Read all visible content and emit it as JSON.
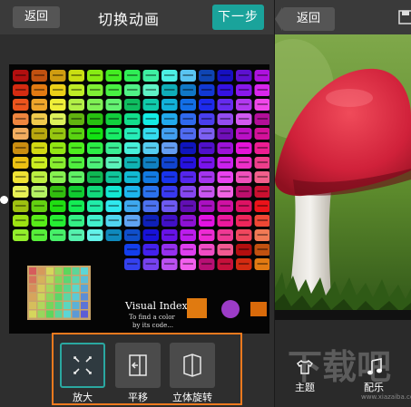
{
  "left": {
    "header": {
      "back_label": "返回",
      "title": "切换动画",
      "next_label": "下一步"
    },
    "preview": {
      "colors": [
        "#ff0000",
        "#ff3300",
        "#ff6600",
        "#ff9900",
        "#ffcc00",
        "#ffff00",
        "#ccff00",
        "#99ff00",
        "#66ff00",
        "#33ff00",
        "#00ff00",
        "#00ff33",
        "#00ff66",
        "#00ff99",
        "#00ffcc",
        "#00ffff",
        "#00ccff",
        "#0099ff",
        "#0066ff",
        "#0033ff",
        "#0000ff",
        "#3300ff",
        "#6600ff",
        "#9900ff",
        "#cc00ff",
        "#ff00ff",
        "#ff00cc",
        "#ff0099",
        "#ff0066",
        "#ff0033",
        "#993300",
        "#996600",
        "#999900",
        "#669900",
        "#339900",
        "#009933",
        "#009966",
        "#009999",
        "#006699",
        "#003399",
        "#330099",
        "#660099",
        "#990099",
        "#990066",
        "#990033",
        "#cc9999",
        "#cccc99",
        "#99cc99",
        "#99cccc",
        "#9999cc",
        "#cc99cc",
        "#ffffff",
        "#cccccc",
        "#999999",
        "#666666",
        "#333333"
      ],
      "visual_index_title": "Visual Index",
      "visual_index_subtitle_1": "To find a color",
      "visual_index_subtitle_2": "by its code..."
    },
    "effects": [
      {
        "label": "放大",
        "icon": "expand-arrows-icon",
        "selected": true
      },
      {
        "label": "平移",
        "icon": "slide-panel-icon",
        "selected": false
      },
      {
        "label": "立体旋转",
        "icon": "cube-rotate-icon",
        "selected": false
      }
    ]
  },
  "right": {
    "header": {
      "back_label": "返回"
    },
    "tabs": [
      {
        "label": "主题",
        "icon": "shirt-icon"
      },
      {
        "label": "配乐",
        "icon": "music-note-icon"
      }
    ],
    "watermark_text": "下载吧",
    "watermark_url": "www.xiazaiba.com"
  },
  "colors": {
    "accent_teal": "#1aa39b",
    "accent_orange": "#f07a1e",
    "toolbar": "#3a3a3a"
  }
}
